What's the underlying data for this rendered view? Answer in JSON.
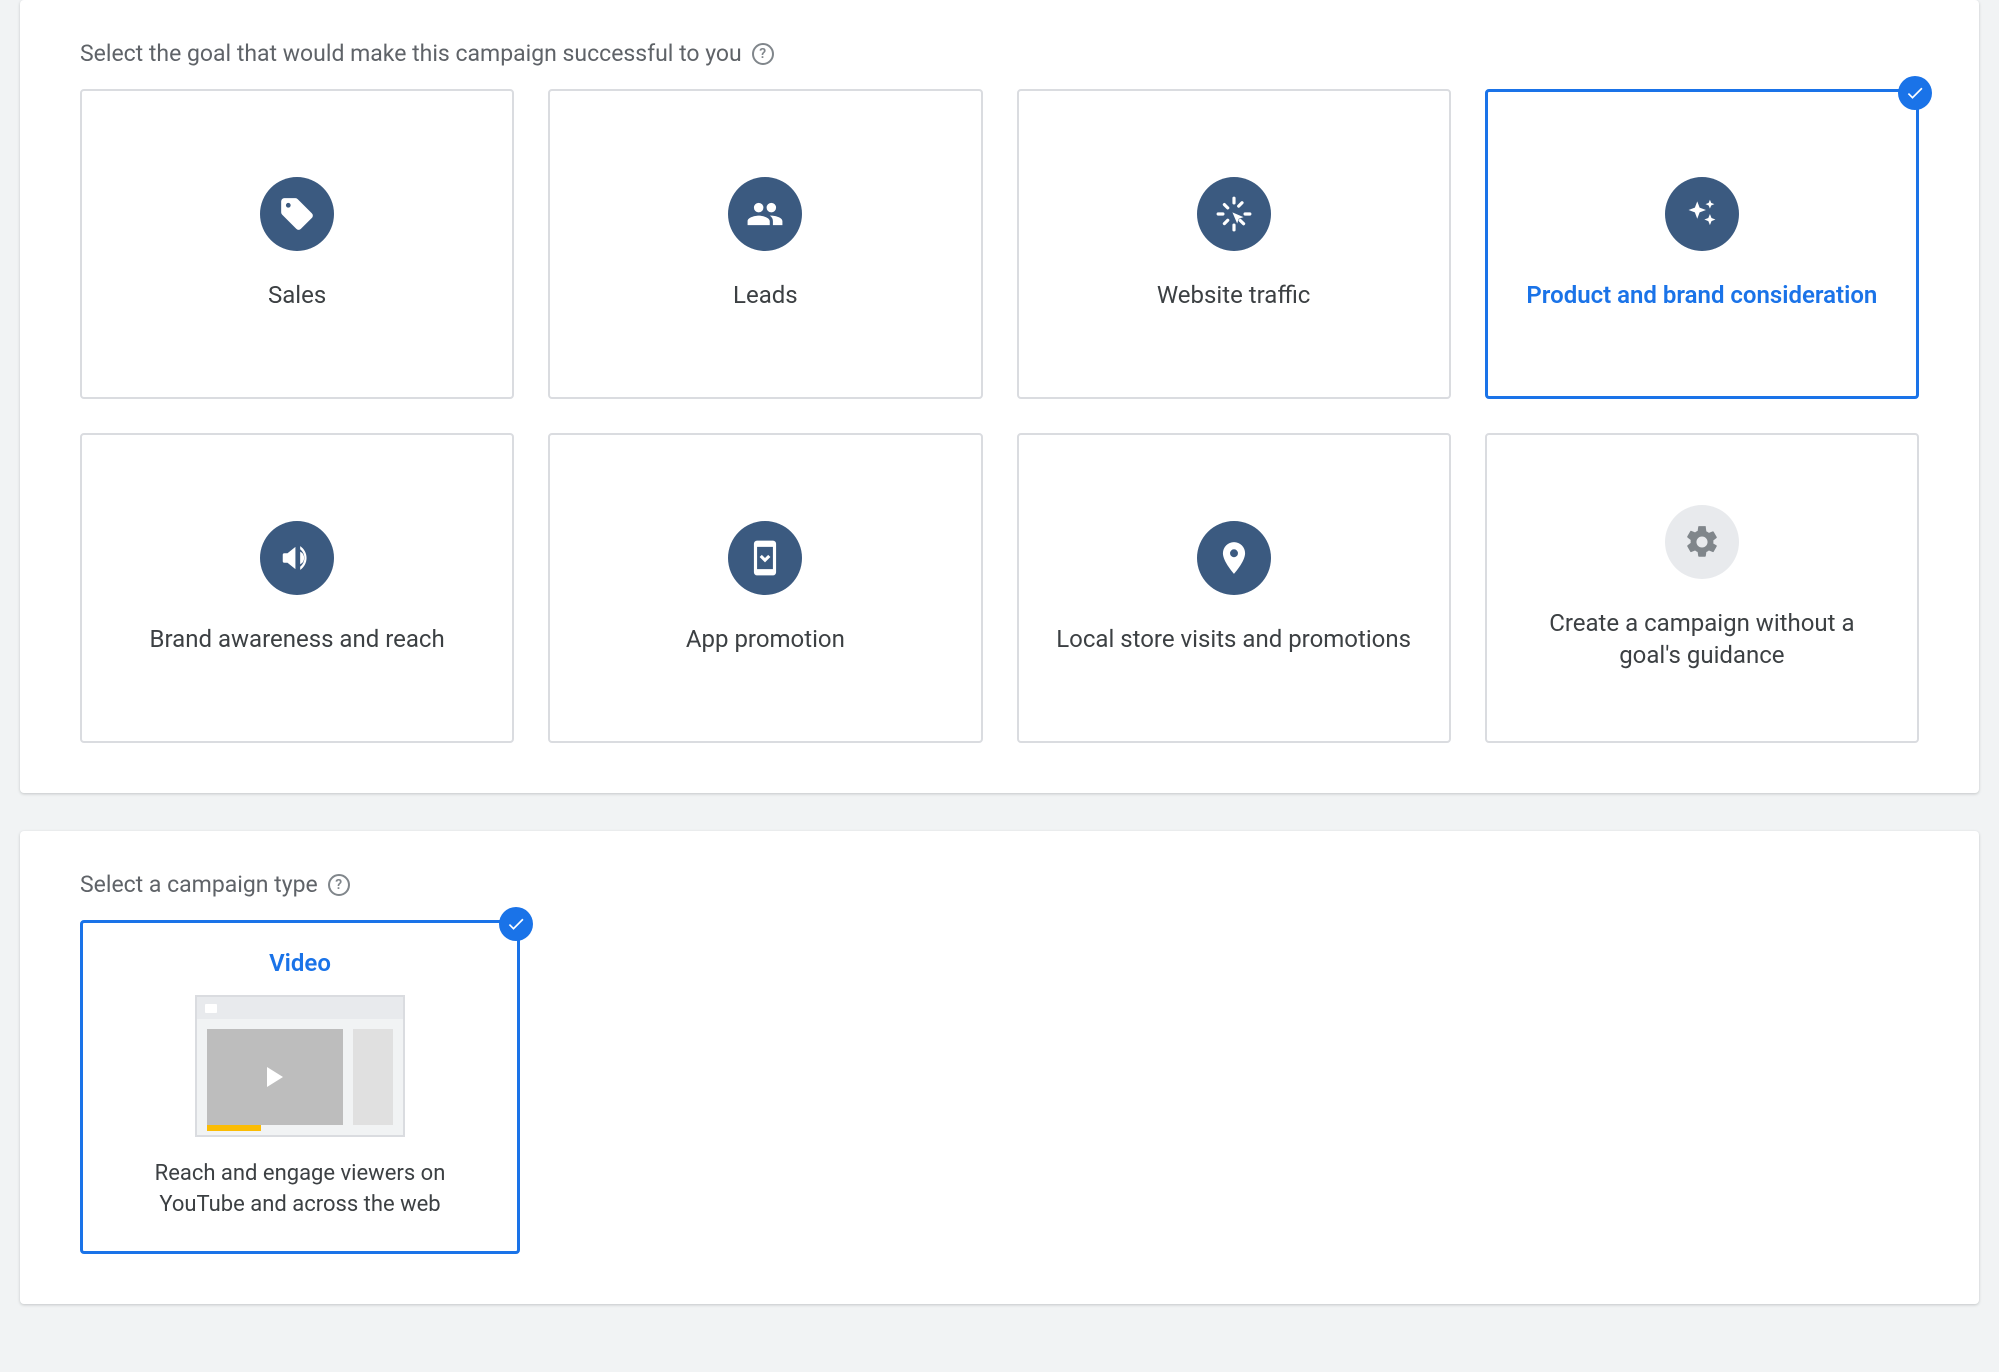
{
  "goal_section": {
    "heading": "Select the goal that would make this campaign successful to you",
    "cards": [
      {
        "label": "Sales",
        "icon": "tag",
        "selected": false,
        "grey": false
      },
      {
        "label": "Leads",
        "icon": "people",
        "selected": false,
        "grey": false
      },
      {
        "label": "Website traffic",
        "icon": "click",
        "selected": false,
        "grey": false
      },
      {
        "label": "Product and brand consideration",
        "icon": "sparkle",
        "selected": true,
        "grey": false
      },
      {
        "label": "Brand awareness and reach",
        "icon": "megaphone",
        "selected": false,
        "grey": false
      },
      {
        "label": "App promotion",
        "icon": "app",
        "selected": false,
        "grey": false
      },
      {
        "label": "Local store visits and promotions",
        "icon": "pin",
        "selected": false,
        "grey": false
      },
      {
        "label": "Create a campaign without a goal's guidance",
        "icon": "gear",
        "selected": false,
        "grey": true
      }
    ]
  },
  "type_section": {
    "heading": "Select a campaign type",
    "cards": [
      {
        "title": "Video",
        "description": "Reach and engage viewers on YouTube and across the web",
        "selected": true
      }
    ]
  }
}
